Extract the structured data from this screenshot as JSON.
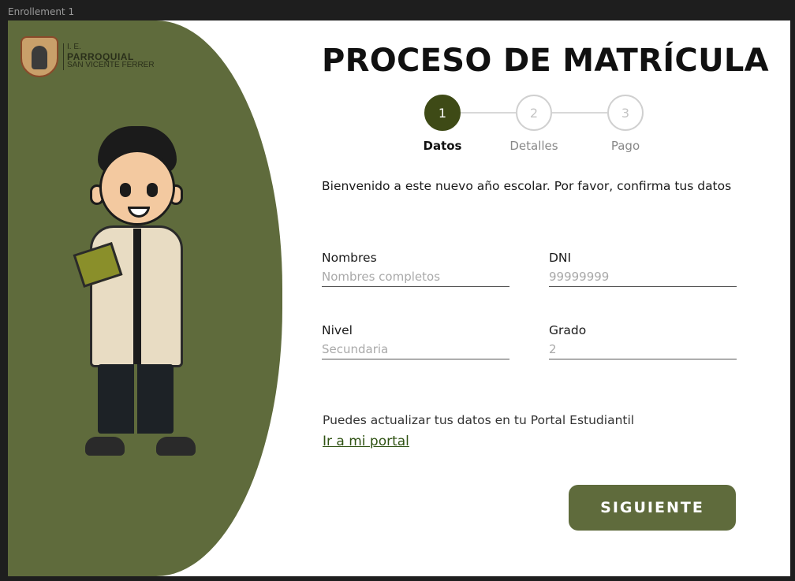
{
  "window": {
    "frame_label": "Enrollement 1"
  },
  "logo": {
    "prefix": "I. E.",
    "name": "PARROQUIAL",
    "subtitle": "SAN VICENTE FERRER"
  },
  "header": {
    "title": "PROCESO DE MATRÍCULA"
  },
  "stepper": {
    "active_index": 0,
    "steps": [
      {
        "number": "1",
        "label": "Datos"
      },
      {
        "number": "2",
        "label": "Detalles"
      },
      {
        "number": "3",
        "label": "Pago"
      }
    ]
  },
  "form": {
    "welcome": "Bienvenido a este nuevo año escolar. Por favor, confirma tus datos",
    "fields": {
      "nombres": {
        "label": "Nombres",
        "placeholder": "Nombres completos",
        "value": ""
      },
      "dni": {
        "label": "DNI",
        "placeholder": "99999999",
        "value": ""
      },
      "nivel": {
        "label": "Nivel",
        "placeholder": "Secundaria",
        "value": ""
      },
      "grado": {
        "label": "Grado",
        "placeholder": "2",
        "value": ""
      }
    }
  },
  "footer": {
    "update_text": "Puedes actualizar tus datos en tu Portal Estudiantil",
    "portal_link": "Ir a mi portal",
    "next_button": "SIGUIENTE"
  },
  "colors": {
    "brand_green": "#5f6b3c",
    "active_step": "#3e4a16",
    "link": "#2f5213"
  },
  "icons": {
    "logo": "school-crest-icon",
    "character": "student-illustration"
  }
}
